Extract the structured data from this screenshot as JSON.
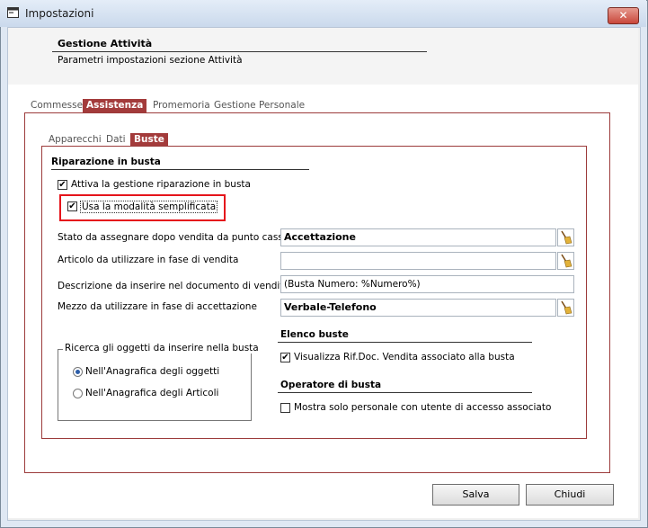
{
  "window": {
    "title": "Impostazioni",
    "close_label": "✕"
  },
  "header": {
    "title": "Gestione Attività",
    "subtitle": "Parametri impostazioni sezione Attività"
  },
  "outer_tabs": [
    {
      "label": "Commesse",
      "active": false
    },
    {
      "label": "Assistenza",
      "active": true
    },
    {
      "label": "Promemoria",
      "active": false
    },
    {
      "label": "Gestione Personale",
      "active": false
    }
  ],
  "inner_tabs": [
    {
      "label": "Apparecchi",
      "active": false
    },
    {
      "label": "Dati",
      "active": false
    },
    {
      "label": "Buste",
      "active": true
    }
  ],
  "riparazione": {
    "title": "Riparazione in busta",
    "attiva_label": "Attiva la gestione riparazione in busta",
    "attiva_checked": true,
    "semplificata_label": "Usa la modalità semplificata",
    "semplificata_checked": true
  },
  "fields": {
    "stato_label": "Stato da assegnare dopo vendita da punto cassa",
    "stato_value": "Accettazione",
    "articolo_label": "Articolo da utilizzare in fase di vendita",
    "articolo_value": "",
    "descrizione_label": "Descrizione da inserire nel documento di vendita",
    "descrizione_value": "(Busta Numero: %Numero%)",
    "mezzo_label": "Mezzo da utilizzare in fase di accettazione",
    "mezzo_value": "Verbale-Telefono"
  },
  "ricerca": {
    "legend": "Ricerca gli oggetti da inserire nella busta",
    "options": [
      {
        "label": "Nell'Anagrafica degli oggetti",
        "selected": true
      },
      {
        "label": "Nell'Anagrafica degli Articoli",
        "selected": false
      }
    ]
  },
  "elenco_buste": {
    "title": "Elenco buste",
    "visualizza_label": "Visualizza Rif.Doc. Vendita associato alla busta",
    "visualizza_checked": true
  },
  "operatore": {
    "title": "Operatore di busta",
    "mostra_label": "Mostra solo personale con utente di accesso associato",
    "mostra_checked": false
  },
  "buttons": {
    "salva": "Salva",
    "chiudi": "Chiudi"
  },
  "icons": {
    "window_icon": "window-icon",
    "broom": "broom-icon"
  },
  "colors": {
    "accent": "#a33b3b",
    "highlight": "#e5141b"
  }
}
